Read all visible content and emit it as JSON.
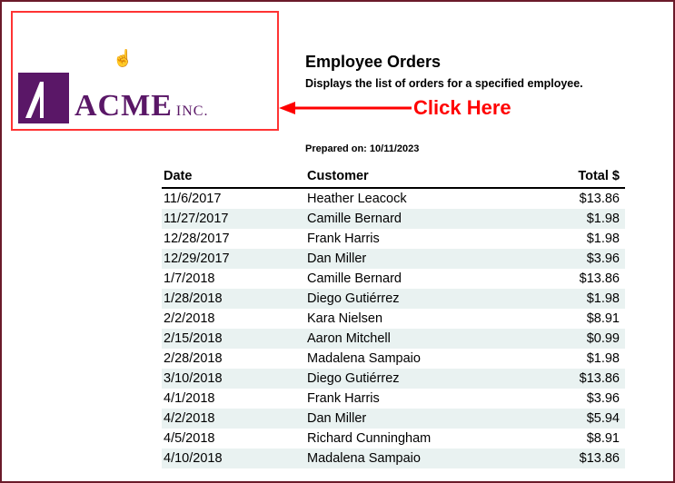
{
  "logo": {
    "brand_primary": "ACME",
    "brand_suffix": "INC."
  },
  "annotation": {
    "label": "Click Here"
  },
  "header": {
    "title": "Employee Orders",
    "subtitle": "Displays the list of orders for a specified employee."
  },
  "meta": {
    "prepared_label": "Prepared on:",
    "prepared_value": "10/11/2023"
  },
  "table": {
    "columns": {
      "date": "Date",
      "customer": "Customer",
      "total": "Total $"
    },
    "rows": [
      {
        "date": "11/6/2017",
        "customer": "Heather Leacock",
        "total": "$13.86"
      },
      {
        "date": "11/27/2017",
        "customer": "Camille Bernard",
        "total": "$1.98"
      },
      {
        "date": "12/28/2017",
        "customer": "Frank Harris",
        "total": "$1.98"
      },
      {
        "date": "12/29/2017",
        "customer": "Dan Miller",
        "total": "$3.96"
      },
      {
        "date": "1/7/2018",
        "customer": "Camille Bernard",
        "total": "$13.86"
      },
      {
        "date": "1/28/2018",
        "customer": "Diego Gutiérrez",
        "total": "$1.98"
      },
      {
        "date": "2/2/2018",
        "customer": "Kara Nielsen",
        "total": "$8.91"
      },
      {
        "date": "2/15/2018",
        "customer": "Aaron Mitchell",
        "total": "$0.99"
      },
      {
        "date": "2/28/2018",
        "customer": "Madalena Sampaio",
        "total": "$1.98"
      },
      {
        "date": "3/10/2018",
        "customer": "Diego Gutiérrez",
        "total": "$13.86"
      },
      {
        "date": "4/1/2018",
        "customer": "Frank Harris",
        "total": "$3.96"
      },
      {
        "date": "4/2/2018",
        "customer": "Dan Miller",
        "total": "$5.94"
      },
      {
        "date": "4/5/2018",
        "customer": "Richard Cunningham",
        "total": "$8.91"
      },
      {
        "date": "4/10/2018",
        "customer": "Madalena Sampaio",
        "total": "$13.86"
      }
    ]
  }
}
